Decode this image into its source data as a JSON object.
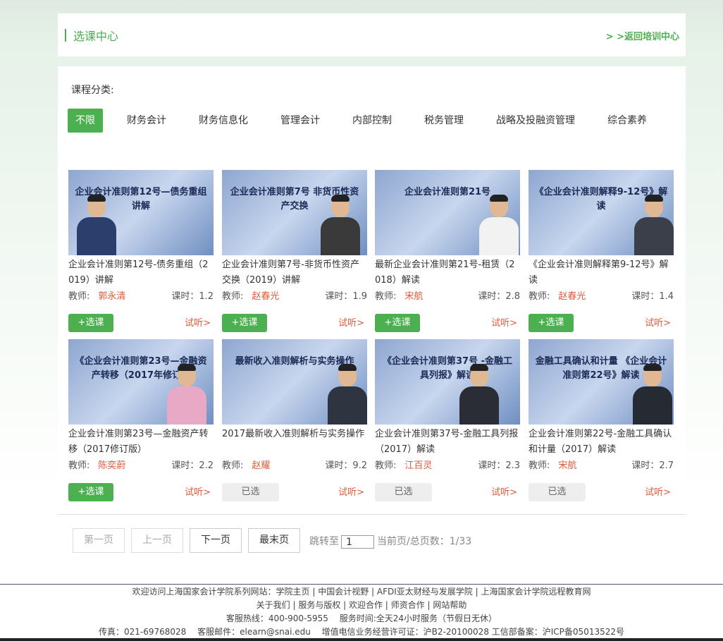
{
  "header": {
    "title": "选课中心",
    "back_link": "> >返回培训中心"
  },
  "categories": {
    "label": "课程分类:",
    "items": [
      "不限",
      "财务会计",
      "财务信息化",
      "管理会计",
      "内部控制",
      "税务管理",
      "战略及投融资管理",
      "综合素养"
    ],
    "active": "不限"
  },
  "courses": [
    {
      "thumb_text": "企业会计准则第12号—债务重组讲解",
      "title": "企业会计准则第12号-债务重组（2019）讲解",
      "teacher_label": "教师:",
      "teacher": "郭永清",
      "hours": "课时：1.2",
      "button": "+选课",
      "selected": false,
      "trial": "试听>"
    },
    {
      "thumb_text": "企业会计准则第7号 非货币性资产交换",
      "title": "企业会计准则第7号-非货币性资产交换（2019）讲解",
      "teacher_label": "教师:",
      "teacher": "赵春光",
      "hours": "课时：1.9",
      "button": "+选课",
      "selected": false,
      "trial": "试听>"
    },
    {
      "thumb_text": "企业会计准则第21号",
      "title": "最新企业会计准则第21号-租赁（2018）解读",
      "teacher_label": "教师:",
      "teacher": "宋航",
      "hours": "课时：2.8",
      "button": "+选课",
      "selected": false,
      "trial": "试听>"
    },
    {
      "thumb_text": "《企业会计准则解释9-12号》解读",
      "title": "《企业会计准则解释第9-12号》解读",
      "teacher_label": "教师:",
      "teacher": "赵春光",
      "hours": "课时：1.4",
      "button": "+选课",
      "selected": false,
      "trial": "试听>"
    },
    {
      "thumb_text": "《企业会计准则第23号—金融资产转移（2017年修订）",
      "title": "企业会计准则第23号—金融资产转移（2017修订版）",
      "teacher_label": "教师:",
      "teacher": "陈奕蔚",
      "hours": "课时：2.2",
      "button": "+选课",
      "selected": false,
      "trial": "试听>"
    },
    {
      "thumb_text": "最新收入准则解析与实务操作",
      "title": "2017最新收入准则解析与实务操作",
      "teacher_label": "教师:",
      "teacher": "赵耀",
      "hours": "课时：9.2",
      "button": "已选",
      "selected": true,
      "trial": "试听>"
    },
    {
      "thumb_text": "《企业会计准则第37号 -金融工具列报》解读",
      "title": "企业会计准则第37号-金融工具列报（2017）解读",
      "teacher_label": "教师:",
      "teacher": "江百灵",
      "hours": "课时：2.3",
      "button": "已选",
      "selected": true,
      "trial": "试听>"
    },
    {
      "thumb_text": "金融工具确认和计量 《企业会计准则第22号》解读",
      "title": "企业会计准则第22号-金融工具确认和计量（2017）解读",
      "teacher_label": "教师:",
      "teacher": "宋航",
      "hours": "课时：2.7",
      "button": "已选",
      "selected": true,
      "trial": "试听>"
    }
  ],
  "pager": {
    "first": "第一页",
    "prev": "上一页",
    "next": "下一页",
    "last": "最末页",
    "jump_label": "跳转至",
    "jump_value": "1",
    "info": "当前页/总页数：1/33"
  },
  "footer": {
    "line1": "欢迎访问上海国家会计学院系列网站：学院主页 | 中国会计视野 | AFDI亚太财经与发展学院 | 上海国家会计学院远程教育网",
    "line2": "关于我们 | 服务与版权 | 欢迎合作 | 师资合作 | 网站帮助",
    "line3": "客服热线：400-900-5955　 服务时间:全天24小时服务（节假日无休）",
    "line4": "传真：021-69768028　 客服邮件：elearn@snai.edu　 增值电信业务经营许可证：沪B2-20100028 工信部备案：沪ICP备05013522号"
  },
  "colors": {
    "accent": "#4caf50",
    "teacher": "#e0593a",
    "trial": "#e0593a"
  }
}
